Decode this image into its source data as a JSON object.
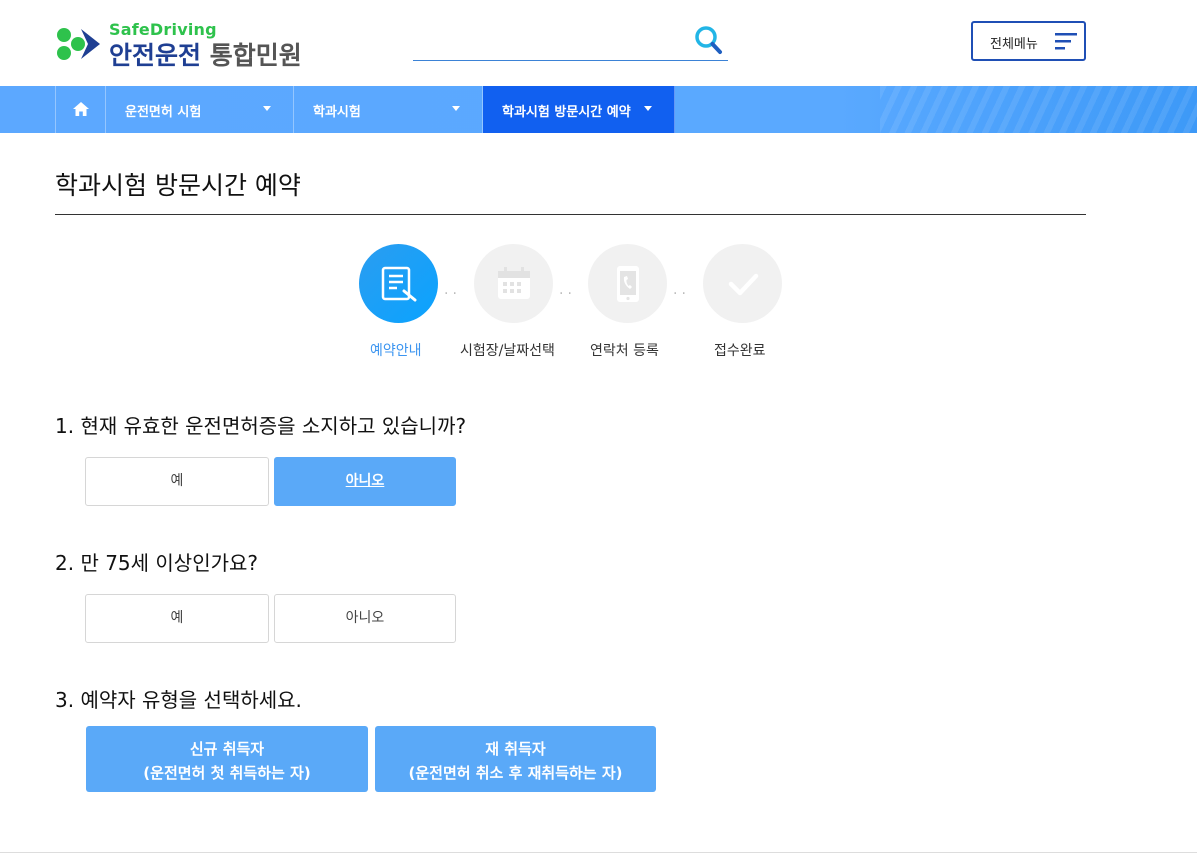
{
  "header": {
    "logo_sub": "SafeDriving",
    "logo_main": "안전운전",
    "logo_main_gray": "통합민원",
    "search_placeholder": "",
    "menu_label": "전체메뉴"
  },
  "nav": {
    "items": [
      {
        "label": "운전면허 시험"
      },
      {
        "label": "학과시험"
      },
      {
        "label": "학과시험 방문시간 예약"
      }
    ]
  },
  "page": {
    "title": "학과시험 방문시간 예약"
  },
  "steps": [
    {
      "label": "예약안내",
      "icon": "document-edit-icon",
      "active": true
    },
    {
      "label": "시험장/날짜선택",
      "icon": "calendar-icon",
      "active": false
    },
    {
      "label": "연락처 등록",
      "icon": "phone-icon",
      "active": false
    },
    {
      "label": "접수완료",
      "icon": "check-icon",
      "active": false
    }
  ],
  "questions": [
    {
      "text": "1. 현재 유효한 운전면허증을 소지하고 있습니까?",
      "options": [
        "예",
        "아니오"
      ],
      "selected": "아니오"
    },
    {
      "text": "2. 만 75세 이상인가요?",
      "options": [
        "예",
        "아니오"
      ],
      "selected": ""
    },
    {
      "text": "3. 예약자 유형을 선택하세요."
    }
  ],
  "types": [
    {
      "line1": "신규 취득자",
      "line2": "(운전면허 첫 취득하는 자)"
    },
    {
      "line1": "재 취득자",
      "line2": "(운전면허 취소 후 재취득하는 자)"
    }
  ],
  "colors": {
    "accent": "#5aa9f8",
    "nav_active": "#1160f0",
    "brand_green": "#2ec24c",
    "brand_navy": "#1f3f93"
  }
}
